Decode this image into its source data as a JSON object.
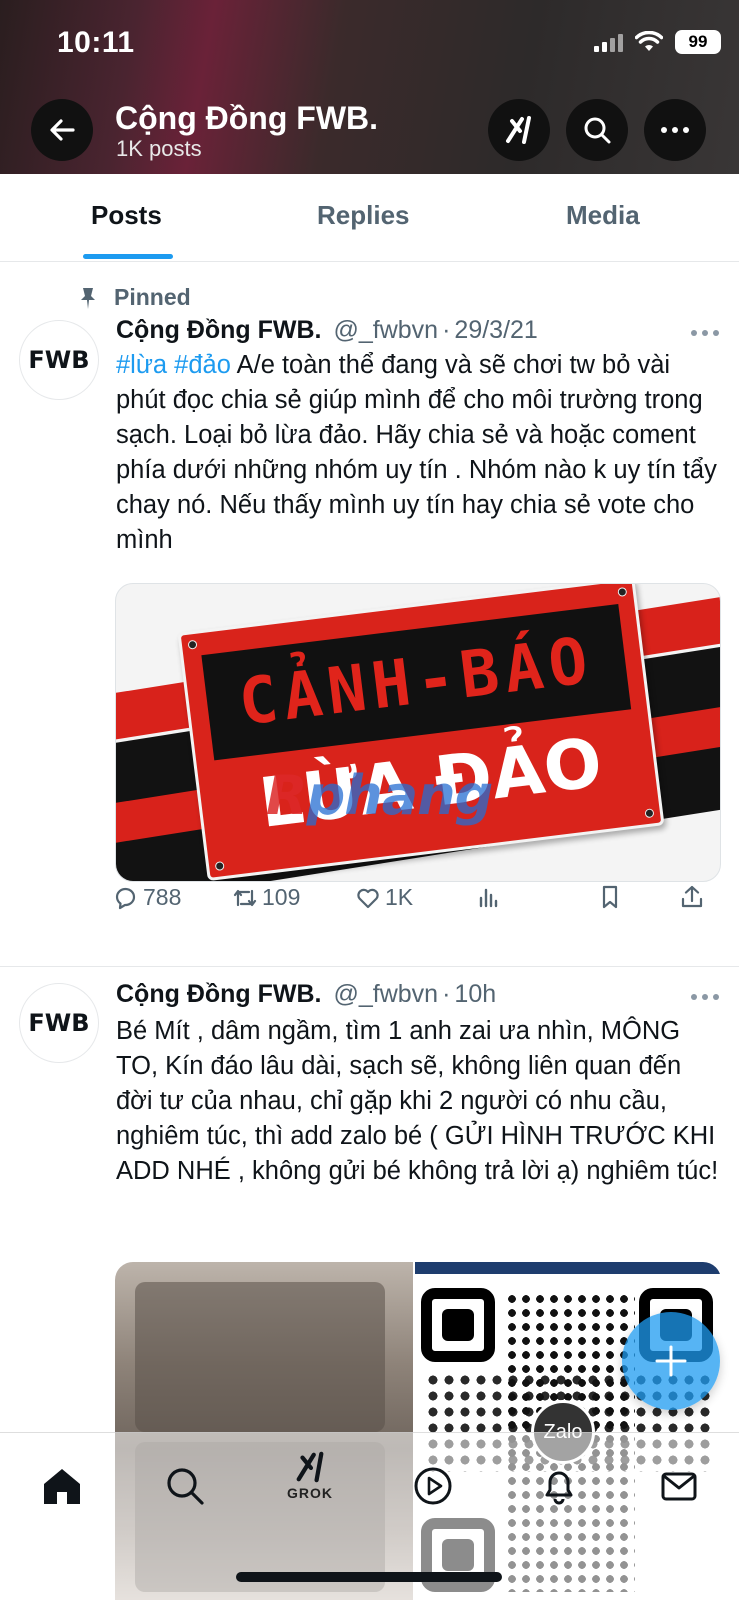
{
  "status_bar": {
    "time": "10:11",
    "battery": "99"
  },
  "profile": {
    "name": "Cộng Đồng FWB.",
    "post_count": "1K posts"
  },
  "tabs": [
    {
      "label": "Posts",
      "active": true
    },
    {
      "label": "Replies",
      "active": false
    },
    {
      "label": "Media",
      "active": false
    }
  ],
  "tweets": [
    {
      "pinned_label": "Pinned",
      "avatar_text": "FWB",
      "name": "Cộng Đồng FWB.",
      "handle": "@_fwbvn",
      "time": "29/3/21",
      "hashtags": "#lừa #đảo",
      "text": " A/e toàn thể đang và sẽ chơi tw bỏ vài phút đọc chia sẻ giúp mình để cho môi trường trong sạch. Loại bỏ lừa đảo. Hãy chia sẻ và hoặc coment phía dưới những nhóm uy tín . Nhóm nào k uy tín tẩy chay nó.  Nếu thấy mình uy tín hay chia sẻ vote cho mình",
      "media": {
        "sign_top": "CẢNH-BÁO",
        "sign_bottom": "LỪA ĐẢO",
        "watermark_red": "R",
        "watermark_blue": "phang"
      },
      "stats": {
        "replies": "788",
        "reposts": "109",
        "likes": "1K"
      }
    },
    {
      "avatar_text": "FWB",
      "name": "Cộng Đồng FWB.",
      "handle": "@_fwbvn",
      "time": "10h",
      "text": "Bé Mít , dâm ngầm, tìm 1 anh zai ưa nhìn, MÔNG TO, Kín đáo lâu dài, sạch sẽ, không liên quan đến đời tư của nhau, chỉ gặp khi 2 người có nhu cầu, nghiêm túc, thì add zalo bé ( GỬI HÌNH TRƯỚC KHI ADD NHÉ , không gửi bé không trả lời ạ) nghiêm túc!",
      "media": {
        "qr_badge": "Zalo"
      }
    }
  ],
  "bottom_nav": {
    "grok_label": "GROK"
  },
  "colors": {
    "accent": "#1d9bf0",
    "secondary_text": "#536471",
    "primary_text": "#0f1419"
  }
}
